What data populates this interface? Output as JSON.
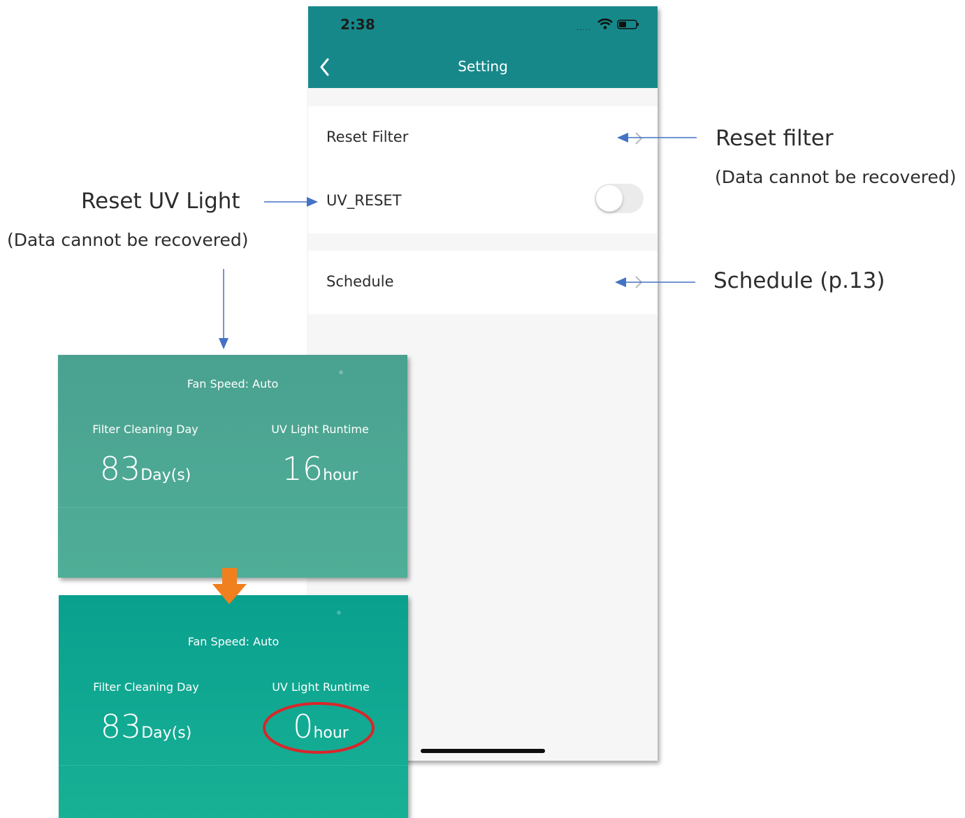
{
  "status_bar": {
    "time": "2:38",
    "signal": "....."
  },
  "nav": {
    "title": "Setting"
  },
  "settings": {
    "reset_filter_label": "Reset Filter",
    "uv_reset_label": "UV_RESET",
    "uv_reset_on": false,
    "schedule_label": "Schedule"
  },
  "annotations": {
    "reset_filter_title": "Reset filter",
    "reset_filter_note": "(Data cannot be recovered)",
    "reset_uv_title": "Reset UV Light",
    "reset_uv_note": "(Data cannot be recovered)",
    "schedule_title": "Schedule (p.13)"
  },
  "panel_before": {
    "fan_speed": "Fan Speed: Auto",
    "filter_label": "Filter Cleaning Day",
    "filter_value": "83",
    "filter_unit": "Day(s)",
    "uv_label": "UV Light Runtime",
    "uv_value": "16",
    "uv_unit": "hour"
  },
  "panel_after": {
    "fan_speed": "Fan Speed: Auto",
    "filter_label": "Filter Cleaning Day",
    "filter_value": "83",
    "filter_unit": "Day(s)",
    "uv_label": "UV Light Runtime",
    "uv_value": "0",
    "uv_unit": "hour"
  },
  "colors": {
    "nav_bar": "#17888a",
    "panel_before": "#4aa190",
    "panel_after": "#09a08e",
    "annotation_arrow": "#4472c4",
    "transition_arrow": "#f07f1e",
    "highlight_ellipse": "#d9262b"
  }
}
